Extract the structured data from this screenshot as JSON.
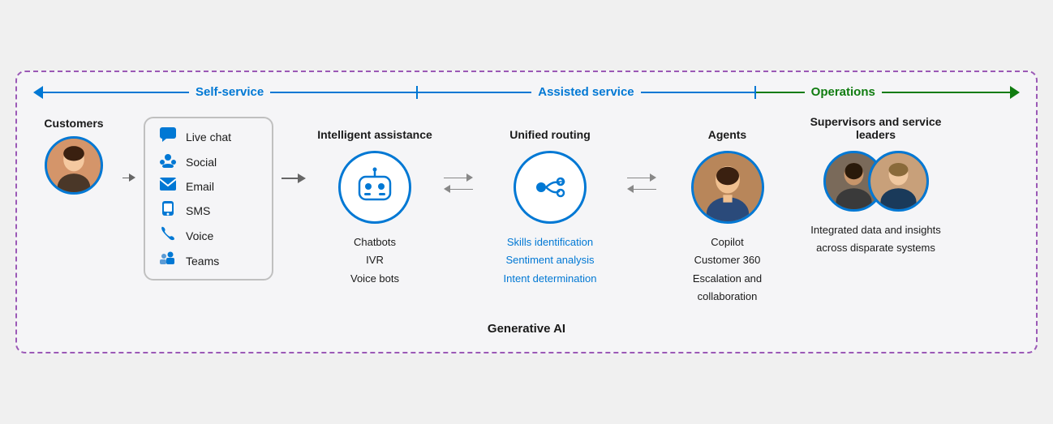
{
  "header": {
    "self_service": "Self-service",
    "assisted_service": "Assisted service",
    "operations": "Operations"
  },
  "customers": {
    "label": "Customers"
  },
  "channels": [
    {
      "icon": "💬",
      "label": "Live chat",
      "name": "live-chat"
    },
    {
      "icon": "👥",
      "label": "Social",
      "name": "social"
    },
    {
      "icon": "✉️",
      "label": "Email",
      "name": "email"
    },
    {
      "icon": "📱",
      "label": "SMS",
      "name": "sms"
    },
    {
      "icon": "📞",
      "label": "Voice",
      "name": "voice"
    },
    {
      "icon": "🔷",
      "label": "Teams",
      "name": "teams"
    }
  ],
  "intelligent_assistance": {
    "title": "Intelligent assistance",
    "items": [
      "Chatbots",
      "IVR",
      "Voice bots"
    ]
  },
  "unified_routing": {
    "title": "Unified routing",
    "items_highlighted": [
      "Skills identification",
      "Sentiment analysis",
      "Intent determination"
    ]
  },
  "agents": {
    "title": "Agents",
    "items": [
      "Copilot",
      "Customer 360",
      "Escalation and collaboration"
    ]
  },
  "supervisors": {
    "title": "Supervisors and service leaders",
    "items": [
      "Integrated data and insights across disparate systems"
    ]
  },
  "footer": {
    "label": "Generative AI"
  }
}
